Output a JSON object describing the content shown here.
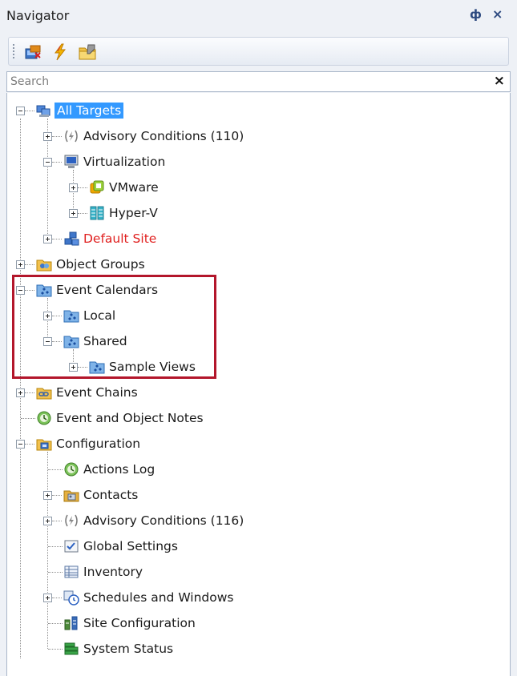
{
  "panel": {
    "title": "Navigator",
    "pin_glyph": "ф",
    "close_glyph": "×"
  },
  "toolbar": {
    "buttons": [
      {
        "icon": "new-targets-icon"
      },
      {
        "icon": "lightning-icon"
      },
      {
        "icon": "folder-edit-icon"
      }
    ]
  },
  "search": {
    "placeholder": "Search",
    "value": "",
    "clear_glyph": "×"
  },
  "tree": {
    "nodes": [
      {
        "label": "All Targets",
        "icon": "all-targets-icon",
        "selected": true
      },
      {
        "label": "Advisory Conditions (110)",
        "icon": "advisory-icon"
      },
      {
        "label": "Virtualization",
        "icon": "monitor-icon"
      },
      {
        "label": "VMware",
        "icon": "vmware-icon"
      },
      {
        "label": "Hyper-V",
        "icon": "hyperv-icon"
      },
      {
        "label": "Default Site",
        "icon": "site-icon",
        "color": "#e0201f"
      },
      {
        "label": "Object Groups",
        "icon": "object-groups-icon"
      },
      {
        "label": "Event Calendars",
        "icon": "calendar-folder-icon"
      },
      {
        "label": "Local",
        "icon": "calendar-folder-icon"
      },
      {
        "label": "Shared",
        "icon": "calendar-folder-icon"
      },
      {
        "label": "Sample Views",
        "icon": "calendar-folder-icon"
      },
      {
        "label": "Event Chains",
        "icon": "event-chains-icon"
      },
      {
        "label": "Event and Object Notes",
        "icon": "notes-icon"
      },
      {
        "label": "Configuration",
        "icon": "configuration-icon"
      },
      {
        "label": "Actions Log",
        "icon": "actions-log-icon"
      },
      {
        "label": "Contacts",
        "icon": "contacts-icon"
      },
      {
        "label": "Advisory Conditions (116)",
        "icon": "advisory-icon"
      },
      {
        "label": "Global Settings",
        "icon": "global-settings-icon"
      },
      {
        "label": "Inventory",
        "icon": "inventory-icon"
      },
      {
        "label": "Schedules and Windows",
        "icon": "schedule-icon"
      },
      {
        "label": "Site Configuration",
        "icon": "site-config-icon"
      },
      {
        "label": "System Status",
        "icon": "system-status-icon"
      }
    ]
  },
  "colors": {
    "selection": "#3399ff",
    "highlight_border": "#b3162b",
    "alert_text": "#e0201f"
  }
}
